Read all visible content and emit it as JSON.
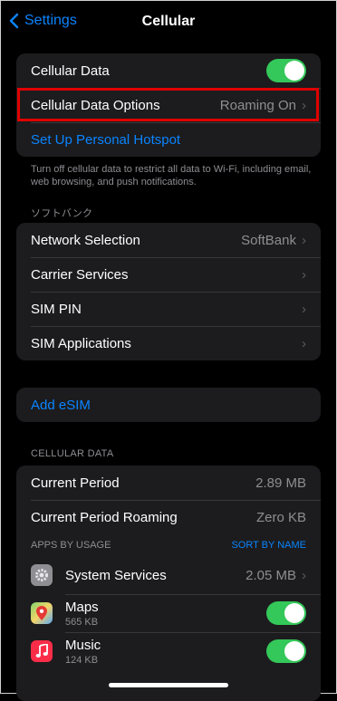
{
  "nav": {
    "back_label": "Settings",
    "title": "Cellular"
  },
  "group1": {
    "cellular_data_label": "Cellular Data",
    "cellular_data_on": true,
    "options_label": "Cellular Data Options",
    "options_value": "Roaming On",
    "hotspot_label": "Set Up Personal Hotspot"
  },
  "footnote": "Turn off cellular data to restrict all data to Wi-Fi, including email, web browsing, and push notifications.",
  "carrier_header": "ソフトバンク",
  "carrier": {
    "network_selection_label": "Network Selection",
    "network_selection_value": "SoftBank",
    "carrier_services_label": "Carrier Services",
    "sim_pin_label": "SIM PIN",
    "sim_apps_label": "SIM Applications"
  },
  "esim": {
    "label": "Add eSIM"
  },
  "cellular_data_header": "CELLULAR DATA",
  "usage": {
    "current_period_label": "Current Period",
    "current_period_value": "2.89 MB",
    "roaming_label": "Current Period Roaming",
    "roaming_value": "Zero KB",
    "apps_header": "APPS BY USAGE",
    "sort_label": "SORT BY NAME",
    "apps": [
      {
        "name": "System Services",
        "value": "2.05 MB",
        "icon": "gear-icon"
      },
      {
        "name": "Maps",
        "sub": "565 KB",
        "icon": "maps-icon",
        "enabled": true
      },
      {
        "name": "Music",
        "sub": "124 KB",
        "icon": "music-icon",
        "enabled": true
      }
    ]
  },
  "colors": {
    "accent": "#0a84ff",
    "toggle_on": "#34c759",
    "highlight": "#e00000",
    "background": "#000000",
    "cell": "#1c1c1e"
  }
}
